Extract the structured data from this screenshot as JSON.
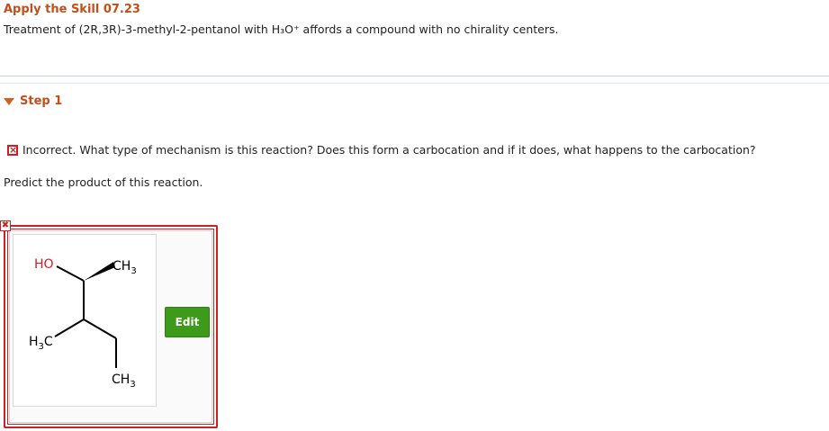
{
  "header": {
    "title": "Apply the Skill 07.23",
    "question": "Treatment of (2R,3R)-3-methyl-2-pentanol with H₃O⁺ affords a compound with no chirality centers."
  },
  "step": {
    "label": "Step 1"
  },
  "feedback": {
    "icon": "x-mark",
    "text": "Incorrect. What type of mechanism is this reaction? Does this form a carbocation and if it does, what happens to the carbocation?"
  },
  "prompt": "Predict the product of this reaction.",
  "answer": {
    "corner_icon": "✖",
    "edit_label": "Edit",
    "labels": {
      "ho": "HO",
      "ch3_top": "CH",
      "ch3_top_sub": "3",
      "h3c": "H",
      "h3c_sub": "3",
      "h3c_c": "C",
      "ch3_bottom": "CH",
      "ch3_bottom_sub": "3"
    }
  },
  "colors": {
    "title": "#c0501a",
    "error": "#cc2027",
    "hydroxyl": "#cc2027",
    "edit_button": "#3d9a1a"
  }
}
